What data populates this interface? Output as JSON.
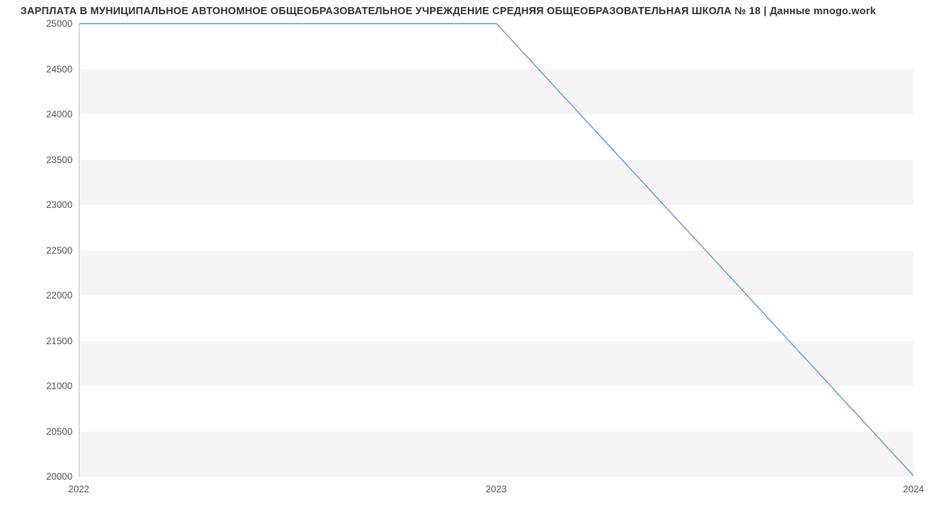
{
  "chart_data": {
    "type": "line",
    "title": "ЗАРПЛАТА В МУНИЦИПАЛЬНОЕ АВТОНОМНОЕ ОБЩЕОБРАЗОВАТЕЛЬНОЕ УЧРЕЖДЕНИЕ СРЕДНЯЯ ОБЩЕОБРАЗОВАТЕЛЬНАЯ ШКОЛА № 18 | Данные mnogo.work",
    "x_categories": [
      "2022",
      "2023",
      "2024"
    ],
    "series": [
      {
        "name": "salary",
        "values": [
          25000,
          25000,
          20000
        ]
      }
    ],
    "xlabel": "",
    "ylabel": "",
    "ylim": [
      20000,
      25000
    ],
    "y_ticks": [
      20000,
      20500,
      21000,
      21500,
      22000,
      22500,
      23000,
      23500,
      24000,
      24500,
      25000
    ],
    "line_color": "#6f9ae3",
    "band_color": "#f5f5f5"
  }
}
